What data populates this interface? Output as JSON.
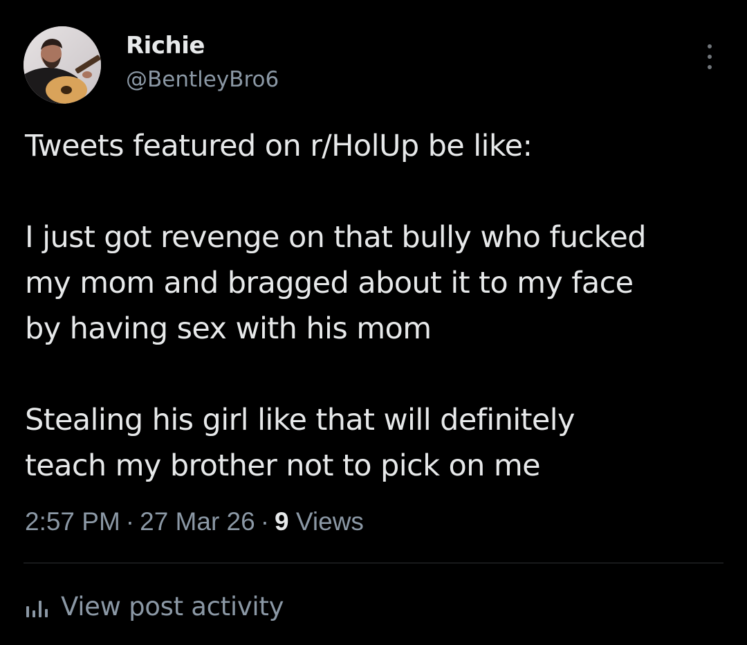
{
  "author": {
    "display_name": "Richie",
    "handle": "@BentleyBro6",
    "avatar": "profile-photo-man-with-guitar"
  },
  "tweet": {
    "paragraphs": [
      "Tweets featured on r/HolUp be like:",
      "I just got revenge on that bully who fucked\nmy mom and bragged about it to my face\nby having sex with his mom",
      "Stealing his girl like that will definitely\nteach my brother not to pick on me"
    ]
  },
  "meta": {
    "time": "2:57 PM",
    "separator": "·",
    "date": "27 Mar 26",
    "views_count": "9",
    "views_label": "Views"
  },
  "actions": {
    "view_activity_label": "View post activity",
    "view_activity_icon": "bar-chart-icon",
    "more_icon": "more-vertical-icon"
  },
  "colors": {
    "background": "#000000",
    "primary_text": "#e7e9ea",
    "secondary_text": "#8b98a5",
    "divider": "#2f3336"
  }
}
